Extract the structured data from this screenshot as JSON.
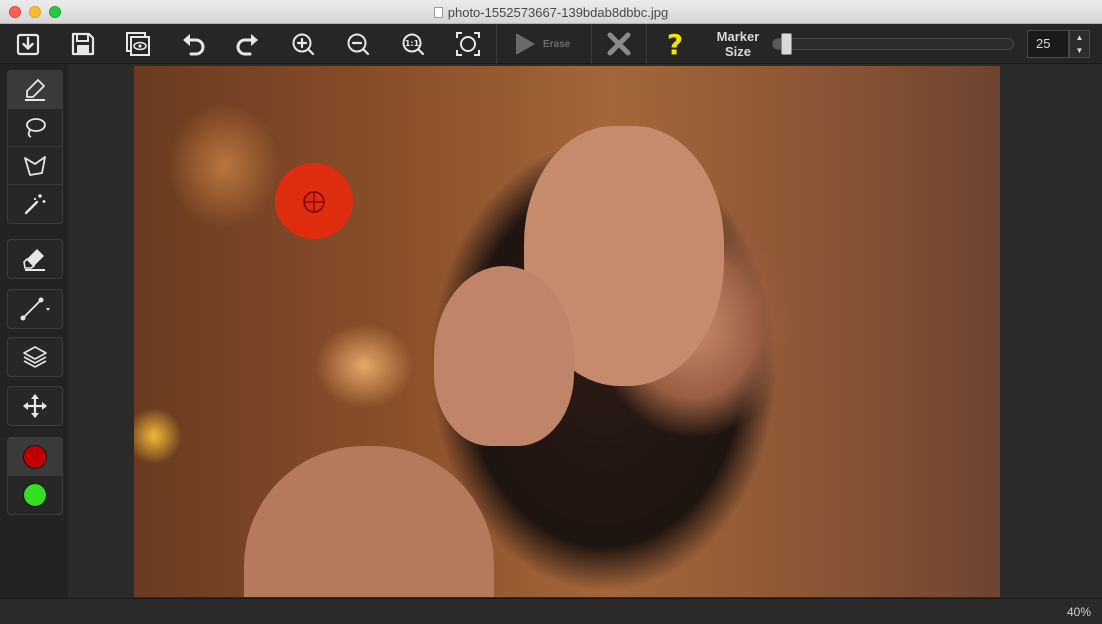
{
  "window": {
    "title": "photo-1552573667-139bdab8dbbc.jpg"
  },
  "toolbar": {
    "buttons": [
      {
        "name": "import-icon"
      },
      {
        "name": "save-icon"
      },
      {
        "name": "preview-icon"
      },
      {
        "name": "undo-icon"
      },
      {
        "name": "redo-icon"
      },
      {
        "name": "zoom-in-icon"
      },
      {
        "name": "zoom-out-icon"
      },
      {
        "name": "zoom-actual-size-icon"
      },
      {
        "name": "zoom-fit-icon"
      }
    ],
    "erase_label": "Erase",
    "marker_label_line1": "Marker",
    "marker_label_line2": "Size",
    "marker_size_value": "25",
    "marker_size_fraction": 0.05,
    "stepper_up": "▲",
    "stepper_down": "▼"
  },
  "tools": {
    "marker": "marker-icon",
    "lasso": "lasso-icon",
    "polygon_lasso": "polygon-lasso-icon",
    "magic_wand": "magic-wand-icon",
    "eraser": "eraser-icon",
    "line": "line-tool-icon",
    "layers": "layers-icon",
    "move": "move-icon"
  },
  "colors": {
    "remove_color": "#c00000",
    "keep_color": "#33e020",
    "accent_help": "#f2e600"
  },
  "status": {
    "zoom": "40%"
  }
}
